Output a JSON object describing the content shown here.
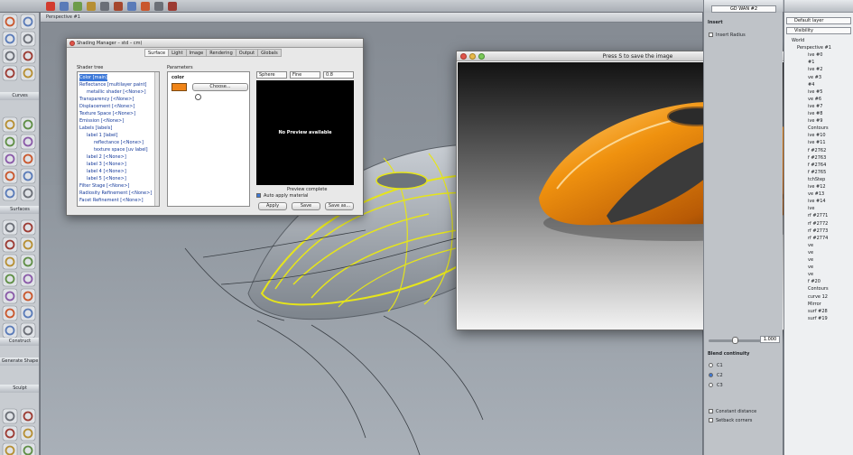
{
  "viewport": {
    "title": "Perspective #1"
  },
  "palette": {
    "sections": [
      "Curves",
      "Surfaces",
      "Construct",
      "Generate Shape",
      "Sculpt"
    ]
  },
  "shading_manager": {
    "title": "Shading Manager – std – cm)",
    "tabs": [
      "Surface",
      "Light",
      "Image",
      "Rendering",
      "Output",
      "Globals"
    ],
    "active_tab": "Surface",
    "shader_tree_label": "Shader tree",
    "parameters_label": "Parameters",
    "tree": [
      {
        "label": "Color [main]",
        "indent": 0,
        "selected": true
      },
      {
        "label": "Reflectance [multilayer paint]",
        "indent": 0,
        "selected": false
      },
      {
        "label": "metallic shader [<None>]",
        "indent": 1,
        "selected": false
      },
      {
        "label": "Transparency [<None>]",
        "indent": 0,
        "selected": false
      },
      {
        "label": "Displacement [<None>]",
        "indent": 0,
        "selected": false
      },
      {
        "label": "Texture Space [<None>]",
        "indent": 0,
        "selected": false
      },
      {
        "label": "Emission [<None>]",
        "indent": 0,
        "selected": false
      },
      {
        "label": "Labels [labels]",
        "indent": 0,
        "selected": false
      },
      {
        "label": "label 1 [label]",
        "indent": 1,
        "selected": false
      },
      {
        "label": "reflectance [<None>]",
        "indent": 2,
        "selected": false
      },
      {
        "label": "texture space [uv label]",
        "indent": 2,
        "selected": false
      },
      {
        "label": "label 2 [<None>]",
        "indent": 1,
        "selected": false
      },
      {
        "label": "label 3 [<None>]",
        "indent": 1,
        "selected": false
      },
      {
        "label": "label 4 [<None>]",
        "indent": 1,
        "selected": false
      },
      {
        "label": "label 5 [<None>]",
        "indent": 1,
        "selected": false
      },
      {
        "label": "Filter Stage [<None>]",
        "indent": 0,
        "selected": false
      },
      {
        "label": "Radiosity Refinement [<None>]",
        "indent": 0,
        "selected": false
      },
      {
        "label": "Facet Refinement [<None>]",
        "indent": 0,
        "selected": false
      }
    ],
    "param_name": "color",
    "color_value": "#f08417",
    "choose_label": "Choose...",
    "preview_shape": "Sphere",
    "preview_quality": "Fine",
    "preview_size": "0.8",
    "preview_text": "No Preview available",
    "preview_status": "Preview complete",
    "auto_apply_label": "Auto apply material",
    "buttons": {
      "apply": "Apply",
      "save": "Save",
      "save_as": "Save as..."
    }
  },
  "render_window": {
    "title": "Press S to save the image",
    "body_color": "#e8880f",
    "grip_color": "#3a3a3a"
  },
  "control_panel": {
    "top_field": "GD WAN #2",
    "insert_label": "Insert",
    "insert_radius_label": "Insert Radius",
    "blend_label": "Blend continuity",
    "options": [
      "C1",
      "C2",
      "C3"
    ],
    "selected_option": "C2",
    "slider_value": "1.000",
    "constant_distance_label": "Constant distance",
    "setback_corners_label": "Setback corners"
  },
  "object_lister": {
    "layer_select": "Default layer",
    "filter_select": "Visibility",
    "items": [
      "World",
      "Perspective #1",
      "ive #0",
      "#1",
      "ive #2",
      "ve #3",
      "#4",
      "ive #5",
      "ve #6",
      "ive #7",
      "ive #8",
      "ive #9",
      "Contours",
      "ive #10",
      "ive #11",
      "f #2762",
      "f #2763",
      "f #2764",
      "f #2765",
      "tchStep",
      "ive #12",
      "ve #13",
      "ive #14",
      "ive",
      "rf #2771",
      "rf #2772",
      "rf #2773",
      "rf #2774",
      "ve",
      "ve",
      "ve",
      "ve",
      "ve",
      "f #20",
      "Contours",
      "curve 12",
      "Mirror",
      "surf #28",
      "surf #19"
    ]
  },
  "colors": {
    "accent": "#3c78d8",
    "curve_yellow": "#e6e51a"
  }
}
